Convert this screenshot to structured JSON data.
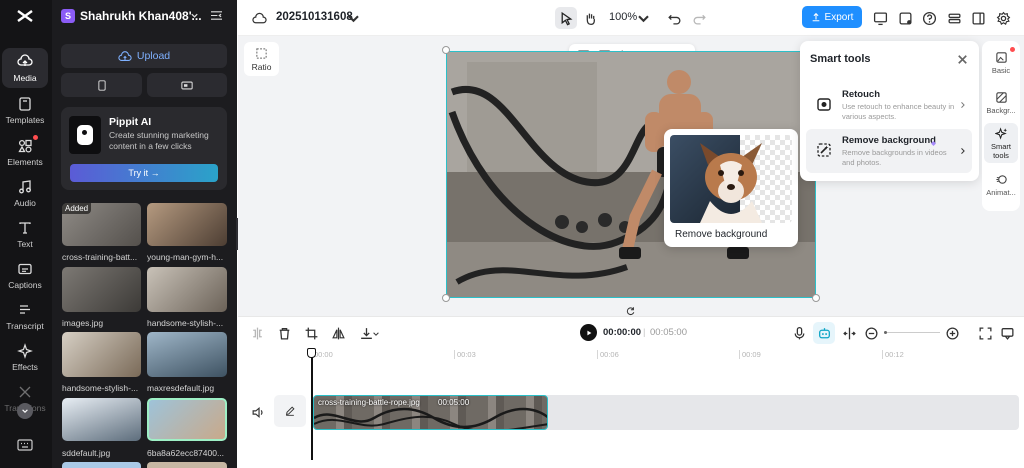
{
  "rail": {
    "items": [
      {
        "label": "Media",
        "icon": "media-icon"
      },
      {
        "label": "Templates",
        "icon": "templates-icon"
      },
      {
        "label": "Elements",
        "icon": "elements-icon"
      },
      {
        "label": "Audio",
        "icon": "audio-icon"
      },
      {
        "label": "Text",
        "icon": "text-icon"
      },
      {
        "label": "Captions",
        "icon": "captions-icon"
      },
      {
        "label": "Transcript",
        "icon": "transcript-icon"
      },
      {
        "label": "Effects",
        "icon": "effects-icon"
      },
      {
        "label": "Transitions",
        "icon": "transitions-icon"
      }
    ]
  },
  "workspace": {
    "badge": "S",
    "name": "Shahrukh Khan408'..."
  },
  "panel": {
    "upload_label": "Upload",
    "promo": {
      "title": "Pippit AI",
      "text": "Create stunning marketing content in a few clicks",
      "button": "Try it →"
    },
    "media": [
      {
        "name": "cross-training-batt...",
        "tag": "Added"
      },
      {
        "name": "young-man-gym-h..."
      },
      {
        "name": "images.jpg"
      },
      {
        "name": "handsome-stylish-..."
      },
      {
        "name": "handsome-stylish-..."
      },
      {
        "name": "maxresdefault.jpg"
      },
      {
        "name": "sddefault.jpg"
      },
      {
        "name": "6ba8a62ecc87400..."
      }
    ]
  },
  "topbar": {
    "project": "20251013160​8",
    "zoom": "100%",
    "export": "Export"
  },
  "canvas": {
    "ratio_label": "Ratio",
    "popup_label": "Remove background"
  },
  "smart_tools": {
    "title": "Smart tools",
    "items": [
      {
        "title": "Retouch",
        "desc": "Use retouch to enhance beauty in various aspects."
      },
      {
        "title": "Remove background",
        "desc": "Remove backgrounds in videos and photos."
      }
    ]
  },
  "right_rail": {
    "items": [
      "Basic",
      "Backgr...",
      "Smart tools",
      "Animat..."
    ]
  },
  "timeline": {
    "current": "00:00:00",
    "total": "00:05:00",
    "ruler": [
      "00:00",
      "00:03",
      "00:06",
      "00:09",
      "00:12"
    ],
    "clip_name": "cross-training-battle-rope.jpg",
    "clip_duration": "00:05:00"
  },
  "colors": {
    "accent": "#1f8fff",
    "clip_border": "#2bc0c9",
    "promo_button": "#3aa4d8"
  }
}
